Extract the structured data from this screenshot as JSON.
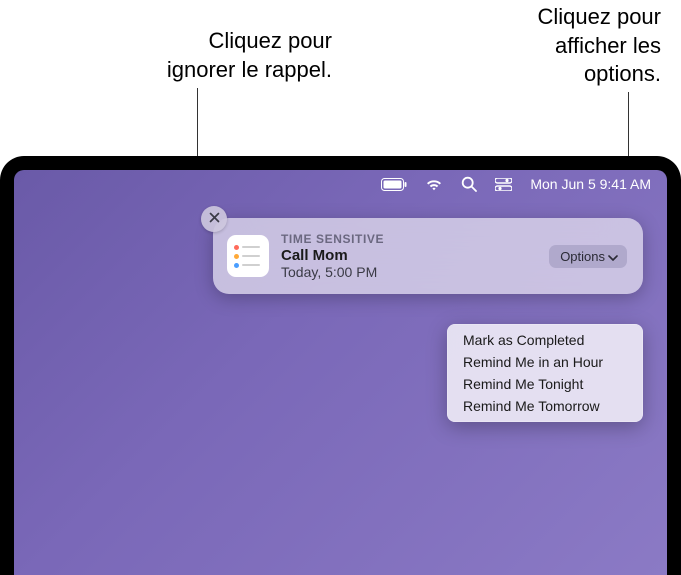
{
  "callouts": {
    "left": "Cliquez pour ignorer le rappel.",
    "right": "Cliquez pour afficher les options."
  },
  "menubar": {
    "datetime": "Mon Jun 5  9:41 AM"
  },
  "notification": {
    "eyebrow": "TIME SENSITIVE",
    "title": "Call Mom",
    "subtitle": "Today, 5:00 PM",
    "options_label": "Options",
    "menu": [
      "Mark as Completed",
      "Remind Me in an Hour",
      "Remind Me Tonight",
      "Remind Me Tomorrow"
    ]
  }
}
